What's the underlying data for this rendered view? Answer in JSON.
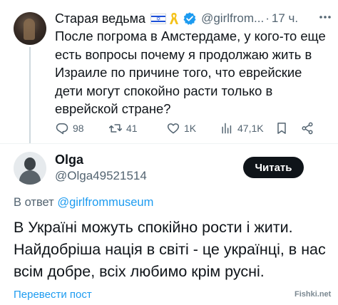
{
  "tweet": {
    "author_name": "Старая ведьма",
    "handle": "@girlfrom...",
    "separator": "·",
    "time": "17 ч.",
    "text": "После погрома в Амстердаме, у кого-то еще есть вопросы почему я продолжаю жить в Израиле по причине того, что еврейские дети могут спокойно расти только в еврейской стране?",
    "stats": {
      "replies": "98",
      "retweets": "41",
      "likes": "1K",
      "views": "47,1K"
    },
    "icons": [
      "israel-flag-icon",
      "yellow-ribbon-icon",
      "verified-badge-icon",
      "more-icon",
      "reply-icon",
      "retweet-icon",
      "like-icon",
      "views-icon",
      "bookmark-icon",
      "share-icon"
    ]
  },
  "reply": {
    "author_name": "Olga",
    "handle": "@Olga49521514",
    "read_button": "Читать",
    "in_reply_prefix": "В ответ",
    "in_reply_handle": "@girlfrommuseum",
    "text": "В Україні можуть спокійно рости і жити. Найдобріша нація в світі - це українці, в нас всім добре, всіх любимо крім русні.",
    "translate_link": "Перевести пост"
  },
  "watermark": "Fishki.net",
  "colors": {
    "text_primary": "#0f1419",
    "text_secondary": "#536471",
    "link": "#1d9bf0",
    "verified": "#1d9bf0",
    "button_bg": "#0f1419",
    "ribbon": "#f4c21a"
  }
}
